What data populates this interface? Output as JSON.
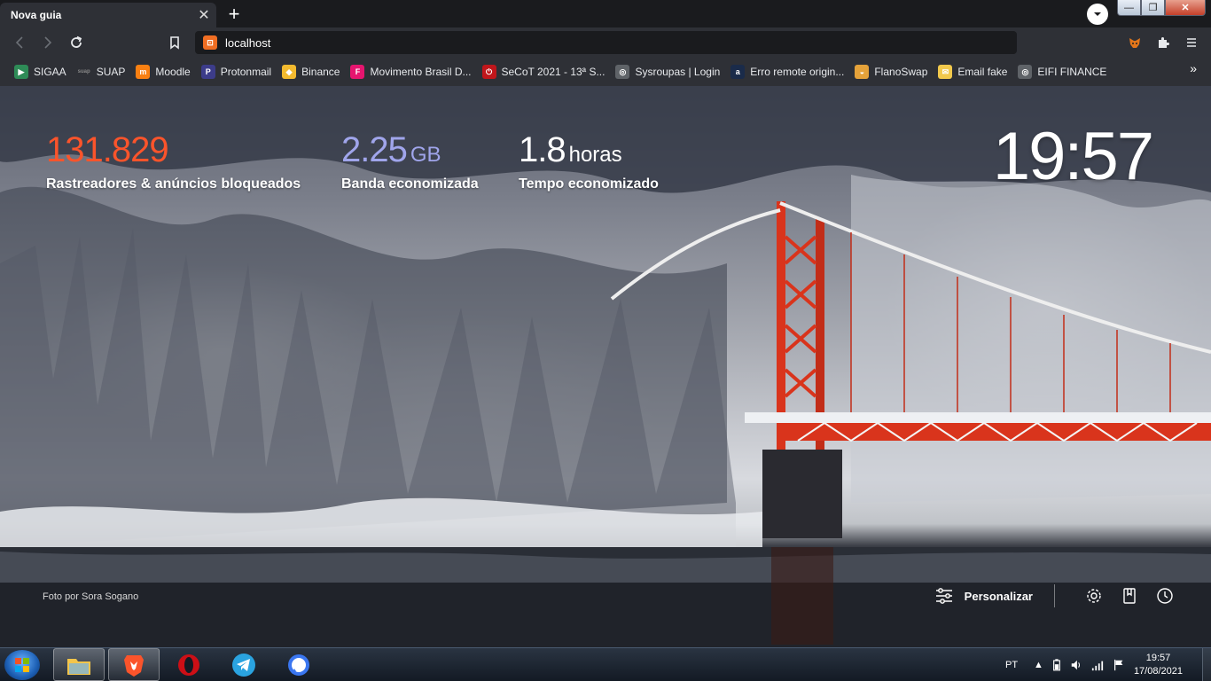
{
  "browser": {
    "tab": {
      "title": "Nova guia",
      "close": "✕"
    },
    "new_tab": "+",
    "window_controls": {
      "minimize": "—",
      "maximize": "❐",
      "close": "✕"
    },
    "url": "localhost",
    "bookmarks": [
      {
        "label": "SIGAA",
        "icon": "sigaa-icon",
        "color": "#2e8b57",
        "glyph": "▶"
      },
      {
        "label": "SUAP",
        "icon": "suap-icon",
        "color": "#2e3036",
        "glyph": "suap"
      },
      {
        "label": "Moodle",
        "icon": "moodle-icon",
        "color": "#f98012",
        "glyph": "m"
      },
      {
        "label": "Protonmail",
        "icon": "protonmail-icon",
        "color": "#3c3c8a",
        "glyph": "P"
      },
      {
        "label": "Binance",
        "icon": "binance-icon",
        "color": "#f3ba2f",
        "glyph": "◆"
      },
      {
        "label": "Movimento Brasil D...",
        "icon": "movimento-icon",
        "color": "#e6156f",
        "glyph": "F"
      },
      {
        "label": "SeCoT 2021 - 13ª S...",
        "icon": "secot-icon",
        "color": "#c0161b",
        "glyph": "⏻"
      },
      {
        "label": "Sysroupas | Login",
        "icon": "globe-icon",
        "color": "#5f6368",
        "glyph": "◎"
      },
      {
        "label": "Erro remote origin...",
        "icon": "a-icon",
        "color": "#1a2b4a",
        "glyph": "a"
      },
      {
        "label": "FlanoSwap",
        "icon": "flanoswap-icon",
        "color": "#e5a23a",
        "glyph": "◒"
      },
      {
        "label": "Email fake",
        "icon": "email-fake-icon",
        "color": "#f2c94c",
        "glyph": "✉"
      },
      {
        "label": "EIFI FINANCE",
        "icon": "globe-icon",
        "color": "#5f6368",
        "glyph": "◎"
      }
    ],
    "bookmarks_more": "»"
  },
  "ntp": {
    "stats": [
      {
        "value": "131.829",
        "unit": "",
        "label": "Rastreadores & anúncios bloqueados",
        "color": "#fb542b"
      },
      {
        "value": "2.25",
        "unit": "GB",
        "label": "Banda economizada",
        "color": "#a0a5eb"
      },
      {
        "value": "1.8",
        "unit": "horas",
        "label": "Tempo economizado",
        "color": "#ffffff"
      }
    ],
    "clock": "19:57",
    "photo_credit": "Foto por Sora Sogano",
    "customize_label": "Personalizar"
  },
  "taskbar": {
    "apps": [
      {
        "name": "explorer",
        "icon": "folder-icon"
      },
      {
        "name": "brave",
        "icon": "brave-icon"
      },
      {
        "name": "opera",
        "icon": "opera-icon"
      },
      {
        "name": "telegram",
        "icon": "telegram-icon"
      },
      {
        "name": "signal",
        "icon": "signal-icon"
      }
    ],
    "language": "PT",
    "time": "19:57",
    "date": "17/08/2021"
  }
}
